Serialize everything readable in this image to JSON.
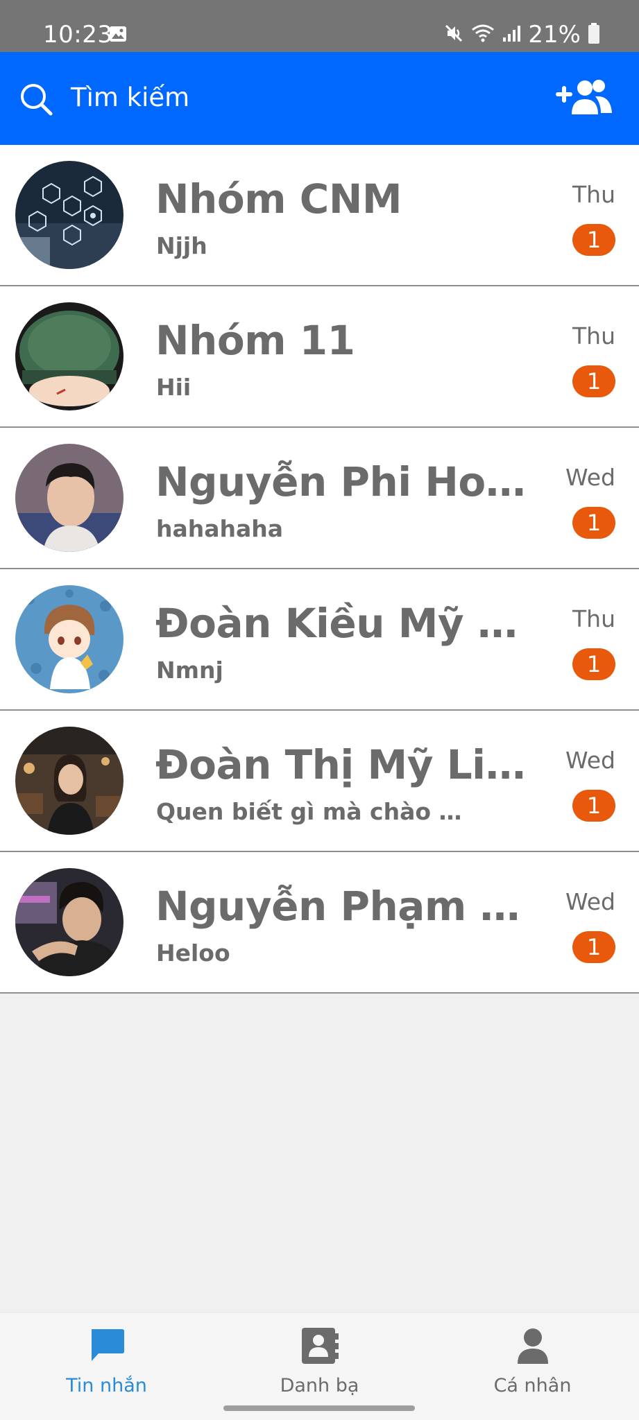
{
  "status_bar": {
    "time": "10:23",
    "battery": "21%",
    "icons": [
      "gallery-icon",
      "mute-icon",
      "wifi-icon",
      "signal-icon",
      "battery-icon"
    ]
  },
  "header": {
    "search_placeholder": "Tìm kiếm",
    "search_icon": "search-icon",
    "add_friend_icon": "add-friend-icon",
    "background": "#0068ff"
  },
  "conversations": [
    {
      "name": "Nhóm CNM",
      "preview": "Njjh",
      "day": "Thu",
      "unread": "1"
    },
    {
      "name": "Nhóm 11",
      "preview": "Hii",
      "day": "Thu",
      "unread": "1"
    },
    {
      "name": "Nguyễn Phi Hoàng",
      "preview": "hahahaha",
      "day": "Wed",
      "unread": "1"
    },
    {
      "name": "Đoàn Kiều Mỹ Ng...",
      "preview": "Nmnj",
      "day": "Thu",
      "unread": "1"
    },
    {
      "name": "Đoàn Thị Mỹ Linh",
      "preview": "Quen biết gì mà chào ko ...",
      "day": "Wed",
      "unread": "1"
    },
    {
      "name": "Nguyễn Phạm Ho...",
      "preview": "Heloo",
      "day": "Wed",
      "unread": "1"
    }
  ],
  "bottom_nav": {
    "items": [
      {
        "label": "Tin nhắn",
        "icon": "chat-bubble-icon",
        "active": true
      },
      {
        "label": "Danh bạ",
        "icon": "contacts-book-icon",
        "active": false
      },
      {
        "label": "Cá nhân",
        "icon": "person-icon",
        "active": false
      }
    ]
  },
  "colors": {
    "accent": "#0068ff",
    "badge": "#e8590c",
    "active_tab": "#2a8bd8",
    "text_muted": "#6b6b6b"
  }
}
